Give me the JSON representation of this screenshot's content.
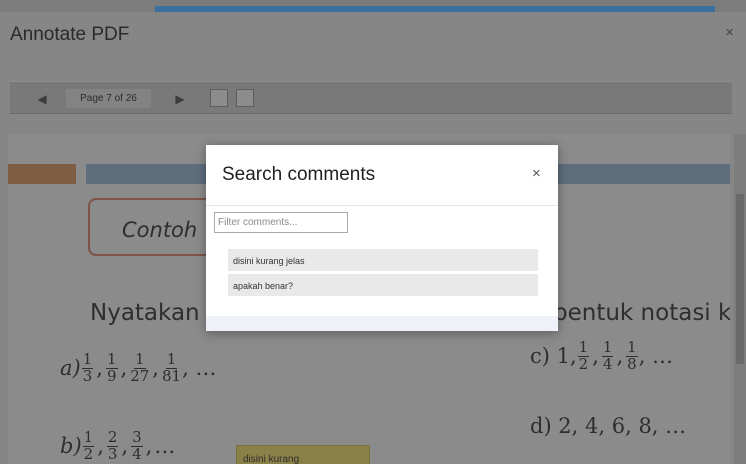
{
  "dialog": {
    "title": "Annotate PDF",
    "close_symbol": "×"
  },
  "toolbar": {
    "page_label": "Page 7 of 26",
    "prev_symbol": "◀",
    "next_symbol": "▶"
  },
  "document": {
    "contoh": "Contoh",
    "nyatakan": "Nyatakan",
    "bentuk": "bentuk notasi ku",
    "a_label": "a)",
    "a_fractions": [
      [
        "1",
        "3"
      ],
      [
        "1",
        "9"
      ],
      [
        "1",
        "27"
      ],
      [
        "1",
        "81"
      ]
    ],
    "a_tail": ", …",
    "b_label": "b)",
    "b_fractions": [
      [
        "1",
        "2"
      ],
      [
        "2",
        "3"
      ],
      [
        "3",
        "4"
      ]
    ],
    "b_tail": "…",
    "c_label": "c) 1,",
    "c_fractions": [
      [
        "1",
        "2"
      ],
      [
        "1",
        "4"
      ],
      [
        "1",
        "8"
      ]
    ],
    "c_tail": ", …",
    "d_text": "d) 2, 4, 6, 8, …",
    "sticky_note": "disini kurang"
  },
  "search_modal": {
    "title": "Search comments",
    "close_symbol": "×",
    "filter_placeholder": "Filter comments...",
    "comments": [
      {
        "text": "disini kurang jelas"
      },
      {
        "text": "apakah benar?"
      }
    ]
  }
}
